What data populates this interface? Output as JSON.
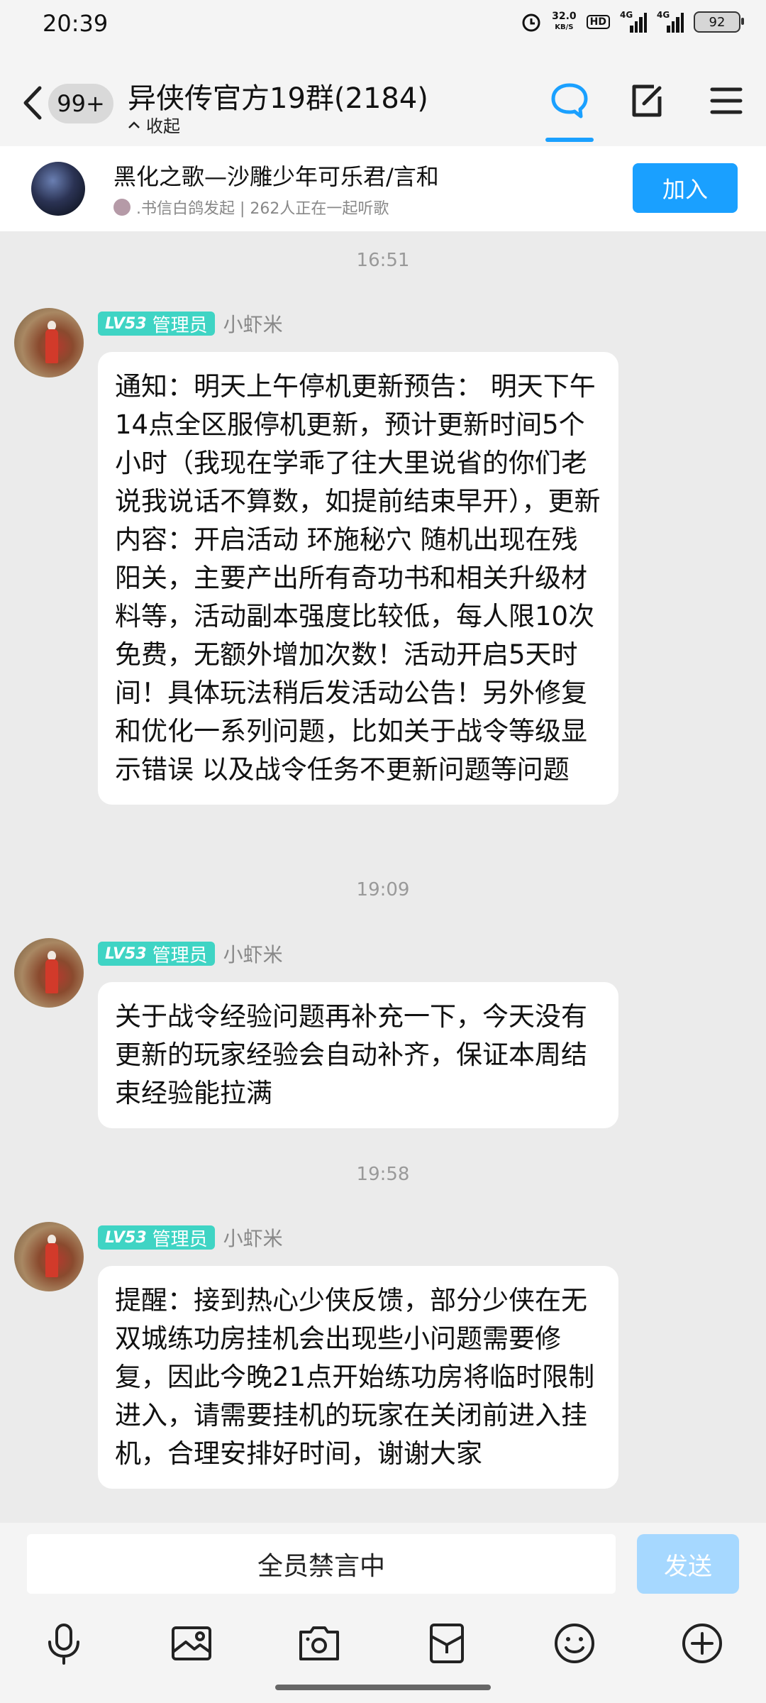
{
  "status_bar": {
    "time": "20:39",
    "net_speed_value": "32.0",
    "net_speed_unit": "KB/S",
    "hd_label": "HD",
    "signal1_label": "4G",
    "signal2_label": "4G",
    "battery": "92"
  },
  "header": {
    "unread_badge": "99+",
    "title": "异侠传官方19群(2184)",
    "collapse_label": "收起"
  },
  "music_banner": {
    "song_title": "黑化之歌—沙雕少年可乐君/言和",
    "subtitle": ".书信白鸽发起 | 262人正在一起听歌",
    "join_label": "加入"
  },
  "messages": [
    {
      "time": "16:51",
      "level": "LV53",
      "role": "管理员",
      "sender": "小虾米",
      "text": "通知：明天上午停机更新预告： 明天下午14点全区服停机更新，预计更新时间5个小时（我现在学乖了往大里说省的你们老说我说话不算数，如提前结束早开），更新内容：开启活动 环施秘穴 随机出现在残阳关，主要产出所有奇功书和相关升级材料等，活动副本强度比较低，每人限10次免费，无额外增加次数！活动开启5天时间！具体玩法稍后发活动公告！另外修复和优化一系列问题，比如关于战令等级显示错误 以及战令任务不更新问题等问题"
    },
    {
      "time": "19:09",
      "level": "LV53",
      "role": "管理员",
      "sender": "小虾米",
      "text": "关于战令经验问题再补充一下，今天没有更新的玩家经验会自动补齐，保证本周结束经验能拉满"
    },
    {
      "time": "19:58",
      "level": "LV53",
      "role": "管理员",
      "sender": "小虾米",
      "text": "提醒：接到热心少侠反馈，部分少侠在无双城练功房挂机会出现些小问题需要修复，因此今晚21点开始练功房将临时限制进入，请需要挂机的玩家在关闭前进入挂机，合理安排好时间，谢谢大家"
    }
  ],
  "input_bar": {
    "muted_text": "全员禁言中",
    "send_label": "发送"
  },
  "colors": {
    "accent": "#1aa0ff",
    "level_badge": "#3fd4c4",
    "send_disabled": "#a6d8ff"
  }
}
